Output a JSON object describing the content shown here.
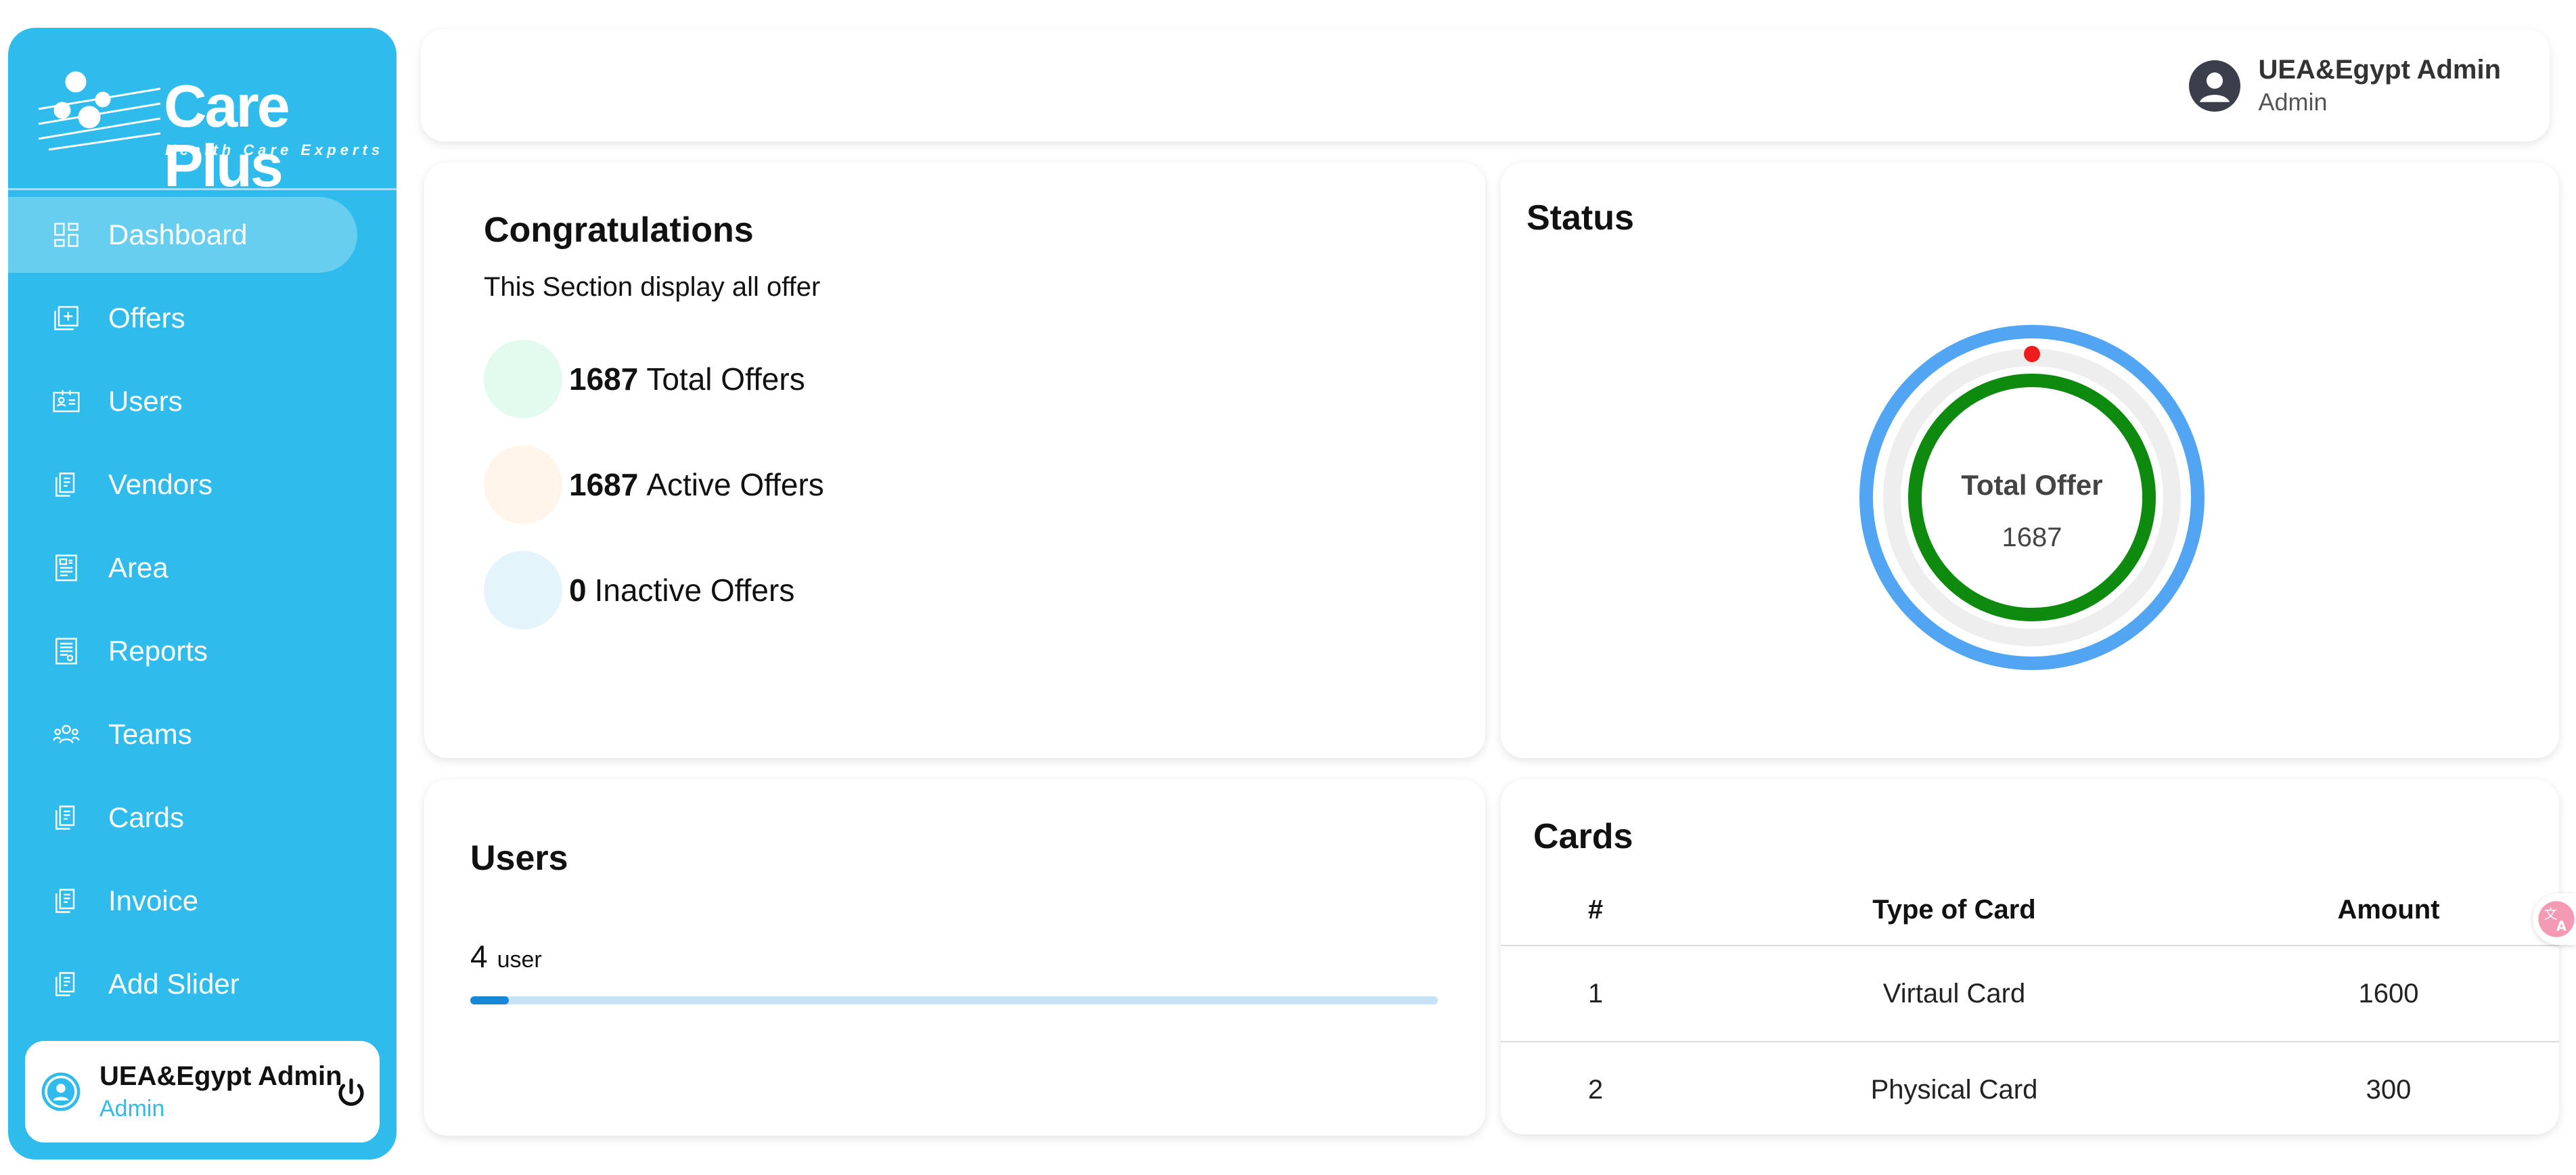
{
  "brand": {
    "name": "Care Plus",
    "tagline": "Health Care Experts"
  },
  "sidebar": {
    "items": [
      {
        "label": "Dashboard",
        "icon": "dashboard-icon",
        "active": true
      },
      {
        "label": "Offers",
        "icon": "offers-icon",
        "active": false
      },
      {
        "label": "Users",
        "icon": "users-icon",
        "active": false
      },
      {
        "label": "Vendors",
        "icon": "vendors-icon",
        "active": false
      },
      {
        "label": "Area",
        "icon": "area-icon",
        "active": false
      },
      {
        "label": "Reports",
        "icon": "reports-icon",
        "active": false
      },
      {
        "label": "Teams",
        "icon": "teams-icon",
        "active": false
      },
      {
        "label": "Cards",
        "icon": "cards-icon",
        "active": false
      },
      {
        "label": "Invoice",
        "icon": "invoice-icon",
        "active": false
      },
      {
        "label": "Add Slider",
        "icon": "add-slider-icon",
        "active": false
      }
    ],
    "user": {
      "name": "UEA&Egypt Admin",
      "role": "Admin"
    }
  },
  "header": {
    "user": {
      "name": "UEA&Egypt Admin",
      "role": "Admin"
    }
  },
  "congrats": {
    "title": "Congratulations",
    "subtitle": "This Section display all offer",
    "stats": [
      {
        "value": "1687",
        "label": "Total Offers",
        "color": "#e3fbef"
      },
      {
        "value": "1687",
        "label": "Active Offers",
        "color": "#fff5ea"
      },
      {
        "value": "0",
        "label": "Inactive Offers",
        "color": "#e3f4fa"
      }
    ]
  },
  "status": {
    "title": "Status",
    "donut_label": "Total Offer",
    "donut_value": "1687",
    "colors": {
      "outer": "#51a5f3",
      "inner": "#0e8a0e",
      "marker": "#ee1c1c",
      "track": "#eeeeee"
    }
  },
  "users": {
    "title": "Users",
    "count": "4",
    "unit": "user",
    "progress": 0.04
  },
  "cards": {
    "title": "Cards",
    "columns": [
      "#",
      "Type of Card",
      "Amount"
    ],
    "rows": [
      [
        "1",
        "Virtaul Card",
        "1600"
      ],
      [
        "2",
        "Physical Card",
        "300"
      ]
    ]
  },
  "colors": {
    "accent": "#2fbbeb"
  }
}
